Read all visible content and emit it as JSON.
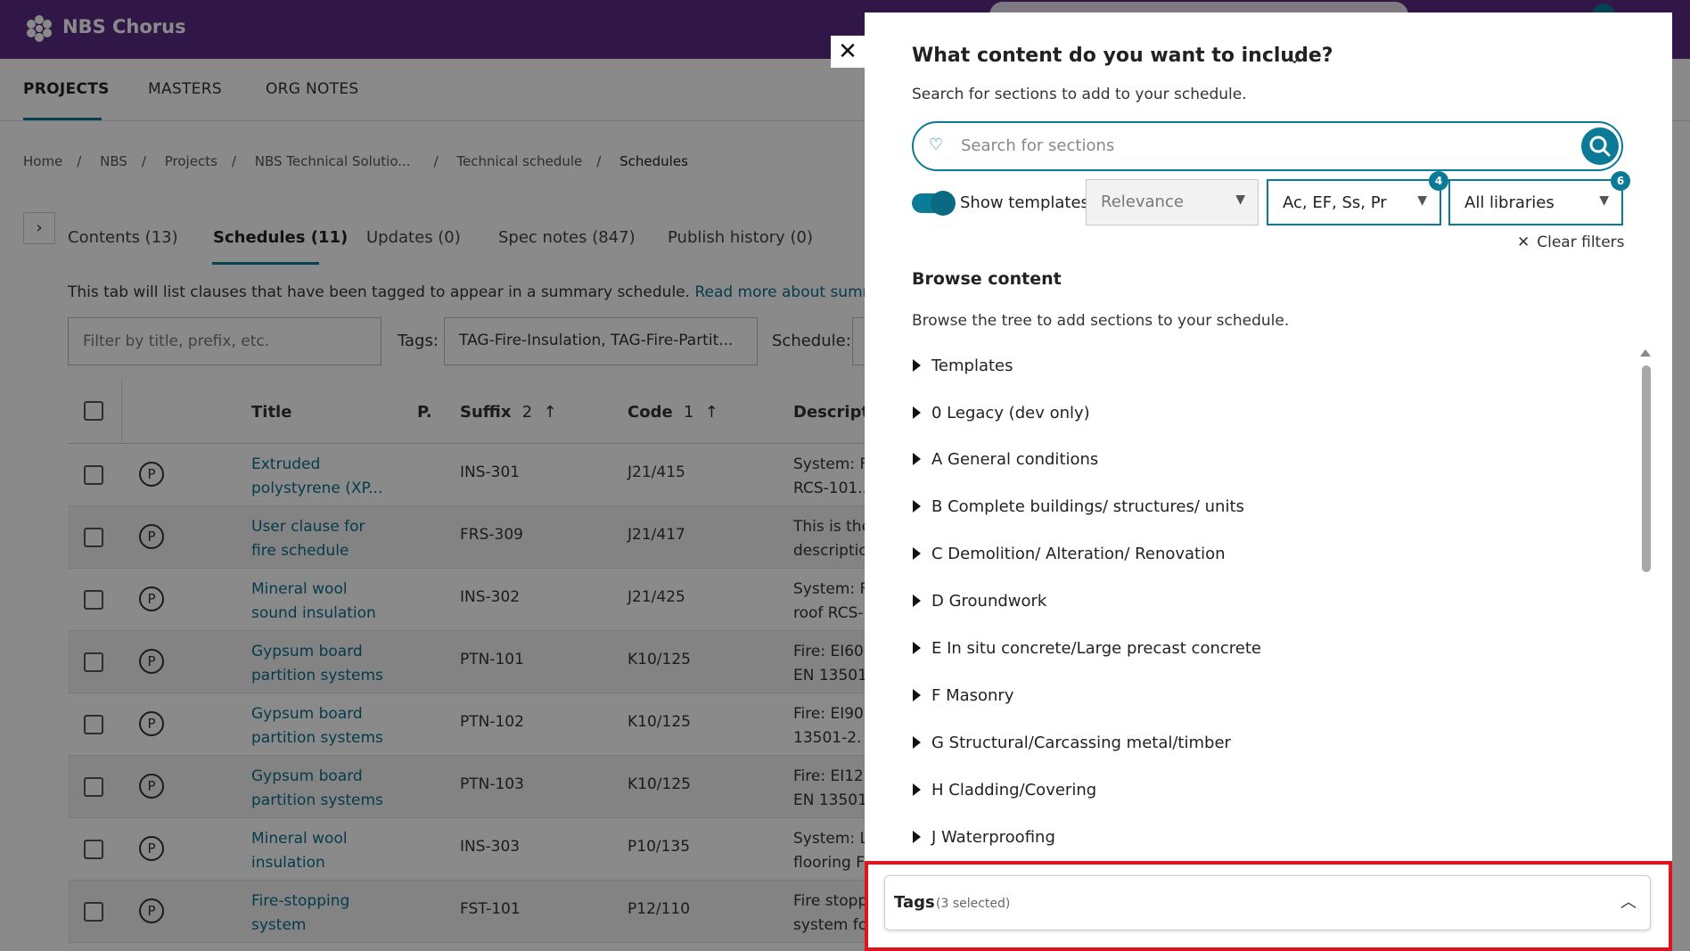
{
  "app": {
    "brand": "NBS Chorus"
  },
  "nav": [
    "PROJECTS",
    "MASTERS",
    "ORG NOTES"
  ],
  "breadcrumb": [
    "Home",
    "NBS",
    "Projects",
    "NBS Technical Solutio...",
    "Technical schedule",
    "Schedules"
  ],
  "tabs": [
    "Contents (13)",
    "Schedules (11)",
    "Updates (0)",
    "Spec notes (847)",
    "Publish history (0)"
  ],
  "info": {
    "text": "This tab will list clauses that have been tagged to appear in a summary schedule.",
    "link": "Read more about summary s"
  },
  "filters": {
    "filter_placeholder": "Filter by title, prefix, etc.",
    "tags_label": "Tags:",
    "tags_value": "TAG-Fire-Insulation, TAG-Fire-Partit...",
    "schedule_label": "Schedule:"
  },
  "table": {
    "headers": {
      "title": "Title",
      "p": "P.",
      "suffix": "Suffix",
      "suffix_sort": "2",
      "code": "Code",
      "code_sort": "1",
      "description": "Descripti"
    },
    "rows": [
      {
        "title1": "Extruded",
        "title2": "polystyrene (XP...",
        "suffix": "INS-301",
        "code": "J21/415",
        "desc1": "System: F",
        "desc2": "RCS-101..."
      },
      {
        "title1": "User clause for",
        "title2": "fire schedule",
        "suffix": "FRS-309",
        "code": "J21/417",
        "desc1": "This is the",
        "desc2": "descriptio"
      },
      {
        "title1": "Mineral wool",
        "title2": "sound insulation",
        "suffix": "INS-302",
        "code": "J21/425",
        "desc1": "System: F",
        "desc2": "roof RCS-"
      },
      {
        "title1": "Gypsum board",
        "title2": "partition systems",
        "suffix": "PTN-101",
        "code": "K10/125",
        "desc1": "Fire: EI60",
        "desc2": "EN 13501-"
      },
      {
        "title1": "Gypsum board",
        "title2": "partition systems",
        "suffix": "PTN-102",
        "code": "K10/125",
        "desc1": "Fire: EI90",
        "desc2": "13501-2."
      },
      {
        "title1": "Gypsum board",
        "title2": "partition systems",
        "suffix": "PTN-103",
        "code": "K10/125",
        "desc1": "Fire: EI12",
        "desc2": "EN 13501-"
      },
      {
        "title1": "Mineral wool",
        "title2": "insulation",
        "suffix": "INS-303",
        "code": "P10/135",
        "desc1": "System: L",
        "desc2": "flooring F"
      },
      {
        "title1": "Fire-stopping",
        "title2": "system",
        "suffix": "FST-101",
        "code": "P12/110",
        "desc1": "Fire stopp",
        "desc2": "system fo"
      }
    ],
    "p_symbol": "P"
  },
  "modal": {
    "title": "What content do you want to include?",
    "subtitle": "Search for sections to add to your schedule.",
    "search_placeholder": "Search for sections",
    "show_templates": "Show templates",
    "sort_value": "Relevance",
    "type_value": "Ac, EF, Ss, Pr",
    "type_badge": "4",
    "library_value": "All libraries",
    "library_badge": "6",
    "clear_filters": "Clear filters",
    "browse_heading": "Browse content",
    "browse_sub": "Browse the tree to add sections to your schedule.",
    "tree": [
      "Templates",
      "0 Legacy (dev only)",
      "A General conditions",
      "B Complete buildings/ structures/ units",
      "C Demolition/ Alteration/ Renovation",
      "D Groundwork",
      "E In situ concrete/Large precast concrete",
      "F Masonry",
      "G Structural/Carcassing metal/timber",
      "H Cladding/Covering",
      "J Waterproofing"
    ],
    "tags_title": "Tags",
    "tags_count": "(3 selected)"
  },
  "colors": {
    "brand": "#5b2a86",
    "accent": "#0a7a96",
    "highlight": "#e0141e"
  }
}
